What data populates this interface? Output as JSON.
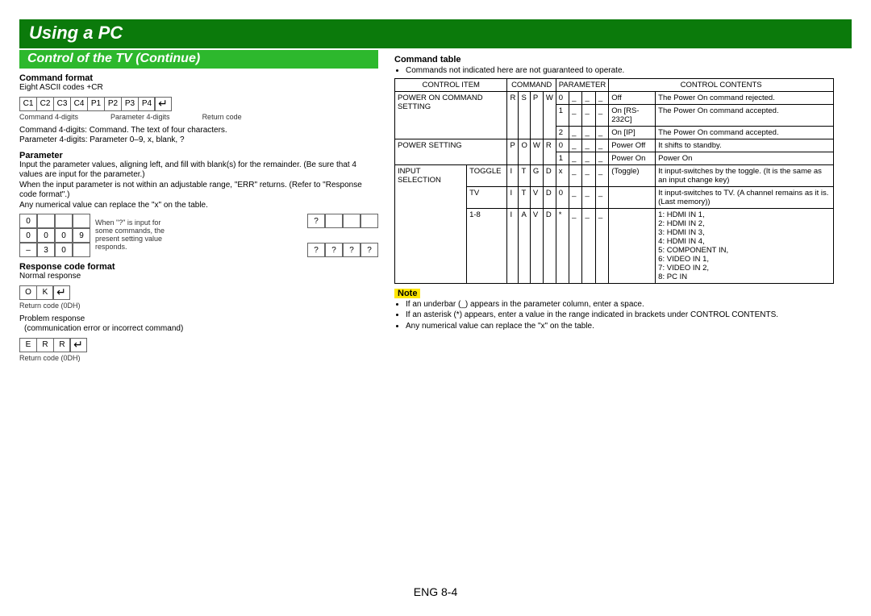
{
  "banner": "Using a PC",
  "sub_banner": "Control of the TV (Continue)",
  "footer": "ENG 8-4",
  "left": {
    "command_format_title": "Command format",
    "command_format_sub": "Eight ASCII codes +CR",
    "cf_boxes": [
      "C1",
      "C2",
      "C3",
      "C4",
      "P1",
      "P2",
      "P3",
      "P4"
    ],
    "cf_ret": "↵",
    "cf_caption_left": "Command 4-digits",
    "cf_caption_mid": "Parameter 4-digits",
    "cf_caption_right": "Return code",
    "cf_desc1": "Command 4-digits: Command. The text of four characters.",
    "cf_desc2": "Parameter 4-digits: Parameter 0–9, x, blank, ?",
    "parameter_title": "Parameter",
    "parameter_p1": "Input the parameter values, aligning left, and fill with blank(s) for the remainder. (Be sure that 4 values are input for the parameter.)",
    "parameter_p2": "When the input parameter is not within an adjustable range, \"ERR\" returns. (Refer to \"Response code format\".)",
    "parameter_p3": "Any numerical value can replace the \"x\" on the table.",
    "param_rows": {
      "r1": [
        "0",
        "",
        "",
        ""
      ],
      "r2": [
        "0",
        "0",
        "0",
        "9"
      ],
      "r3": [
        "–",
        "3",
        "0",
        ""
      ],
      "q1": [
        "?",
        "",
        "",
        ""
      ],
      "q2": [
        "?",
        "?",
        "?",
        "?"
      ]
    },
    "param_mid_caption": "When \"?\" is input for some commands, the present setting value responds.",
    "response_title": "Response code format",
    "response_normal": "Normal response",
    "ok_boxes": [
      "O",
      "K"
    ],
    "ok_ret": "↵",
    "ok_caption": "Return code (0DH)",
    "response_problem": "Problem response",
    "response_problem_sub": "(communication error or incorrect command)",
    "err_boxes": [
      "E",
      "R",
      "R"
    ],
    "err_ret": "↵",
    "err_caption": "Return code (0DH)"
  },
  "right": {
    "command_table_title": "Command table",
    "command_table_sub": "Commands not indicated here are not guaranteed to operate.",
    "headers": {
      "control_item": "CONTROL ITEM",
      "command": "COMMAND",
      "parameter": "PARAMETER",
      "control_contents": "CONTROL CONTENTS"
    },
    "rows": [
      {
        "item": "POWER ON COMMAND SETTING",
        "sub": "",
        "cmd": [
          "R",
          "S",
          "P",
          "W"
        ],
        "param": [
          "0",
          "_",
          "_",
          "_"
        ],
        "pname": "Off",
        "desc": "The Power On command rejected."
      },
      {
        "item": "",
        "sub": "",
        "cmd": [
          "",
          "",
          "",
          ""
        ],
        "param": [
          "1",
          "_",
          "_",
          "_"
        ],
        "pname": "On [RS-232C]",
        "desc": "The Power On command accepted."
      },
      {
        "item": "",
        "sub": "",
        "cmd": [
          "",
          "",
          "",
          ""
        ],
        "param": [
          "2",
          "_",
          "_",
          "_"
        ],
        "pname": "On [IP]",
        "desc": "The Power On command accepted."
      },
      {
        "item": "POWER SETTING",
        "sub": "",
        "cmd": [
          "P",
          "O",
          "W",
          "R"
        ],
        "param": [
          "0",
          "_",
          "_",
          "_"
        ],
        "pname": "Power Off",
        "desc": "It shifts to standby."
      },
      {
        "item": "",
        "sub": "",
        "cmd": [
          "",
          "",
          "",
          ""
        ],
        "param": [
          "1",
          "_",
          "_",
          "_"
        ],
        "pname": "Power On",
        "desc": "Power On"
      },
      {
        "item": "INPUT SELECTION",
        "sub": "TOGGLE",
        "cmd": [
          "I",
          "T",
          "G",
          "D"
        ],
        "param": [
          "x",
          "_",
          "_",
          "_"
        ],
        "pname": "(Toggle)",
        "desc": "It input-switches by the toggle. (It is the same as an input change key)"
      },
      {
        "item": "",
        "sub": "TV",
        "cmd": [
          "I",
          "T",
          "V",
          "D"
        ],
        "param": [
          "0",
          "_",
          "_",
          "_"
        ],
        "pname": "",
        "desc": "It input-switches to TV. (A channel remains as it is. (Last memory))"
      },
      {
        "item": "",
        "sub": "1-8",
        "cmd": [
          "I",
          "A",
          "V",
          "D"
        ],
        "param": [
          "*",
          "_",
          "_",
          "_"
        ],
        "pname": "",
        "desc": "1: HDMI IN 1,\n2: HDMI IN 2,\n3: HDMI IN 3,\n4: HDMI IN 4,\n5: COMPONENT IN,\n6: VIDEO IN 1,\n7: VIDEO IN 2,\n8: PC IN"
      }
    ],
    "note_label": "Note",
    "notes": [
      "If an underbar (_) appears in the parameter column, enter a space.",
      "If an asterisk (*) appears, enter a value in the range indicated in brackets under CONTROL CONTENTS.",
      "Any numerical value can replace the \"x\" on the table."
    ]
  }
}
